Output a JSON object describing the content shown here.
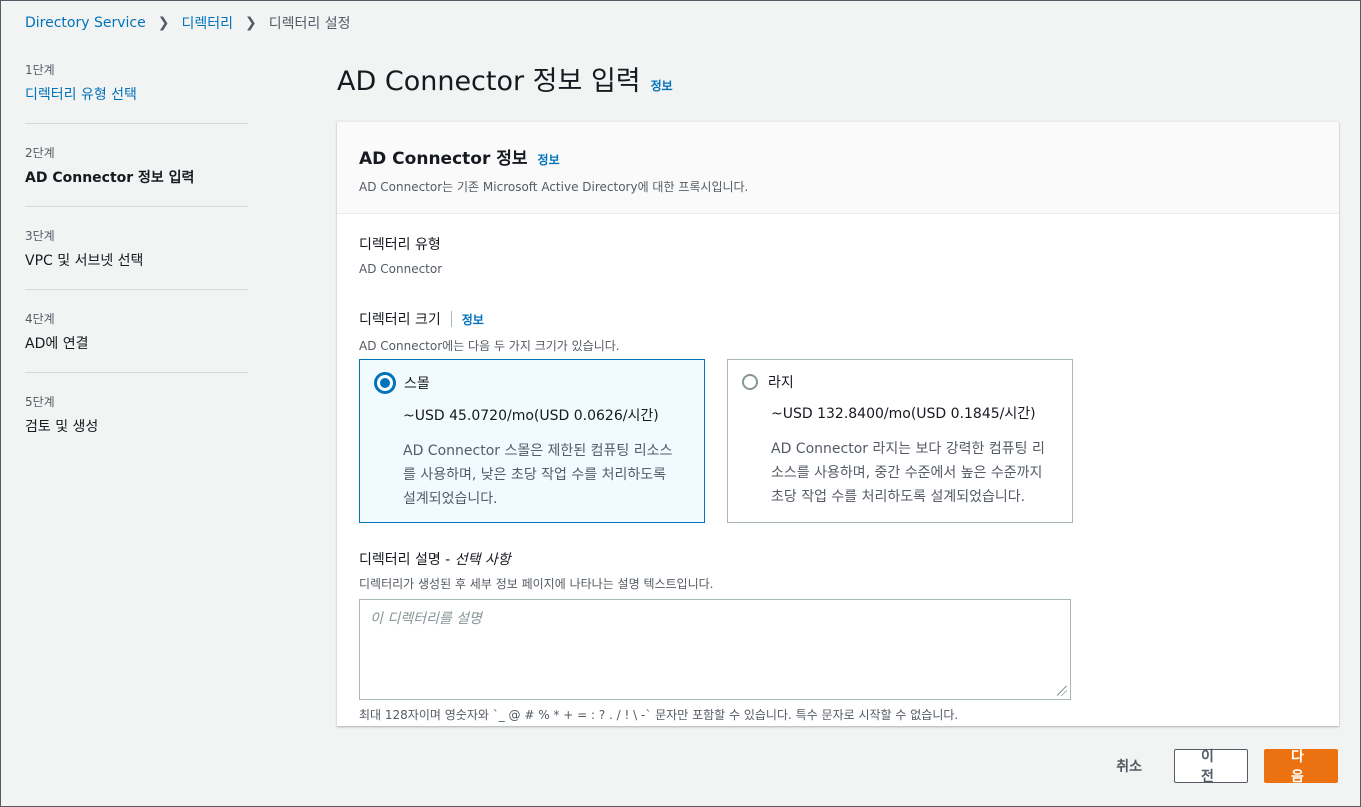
{
  "breadcrumb": {
    "items": [
      "Directory Service",
      "디렉터리"
    ],
    "current": "디렉터리 설정"
  },
  "steps": [
    {
      "num": "1단계",
      "label": "디렉터리 유형 선택"
    },
    {
      "num": "2단계",
      "label": "AD Connector 정보 입력"
    },
    {
      "num": "3단계",
      "label": "VPC 및 서브넷 선택"
    },
    {
      "num": "4단계",
      "label": "AD에 연결"
    },
    {
      "num": "5단계",
      "label": "검토 및 생성"
    }
  ],
  "page": {
    "title": "AD Connector 정보 입력",
    "info": "정보"
  },
  "panel": {
    "title": "AD Connector 정보",
    "info": "정보",
    "description": "AD Connector는 기존 Microsoft Active Directory에 대한 프록시입니다."
  },
  "directory_type": {
    "label": "디렉터리 유형",
    "value": "AD Connector"
  },
  "directory_size": {
    "label": "디렉터리 크기",
    "info": "정보",
    "description": "AD Connector에는 다음 두 가지 크기가 있습니다.",
    "options": [
      {
        "name": "스몰",
        "price": "~USD 45.0720/mo(USD 0.0626/시간)",
        "desc": [
          "AD Connector 스몰은 제한된 컴퓨팅 리소스",
          "를 사용하며, 낮은 초당 작업 수를 처리하도록",
          "설계되었습니다."
        ],
        "selected": true
      },
      {
        "name": "라지",
        "price": "~USD 132.8400/mo(USD 0.1845/시간)",
        "desc": [
          "AD Connector 라지는 보다 강력한 컴퓨팅 리",
          "소스를 사용하며, 중간 수준에서 높은 수준까지",
          "초당 작업 수를 처리하도록 설계되었습니다."
        ],
        "selected": false
      }
    ]
  },
  "directory_description": {
    "label": "디렉터리 설명 - ",
    "optional": "선택 사항",
    "help": "디렉터리가 생성된 후 세부 정보 페이지에 나타나는 설명 텍스트입니다.",
    "placeholder": "이 디렉터리를 설명",
    "constraint": "최대 128자이며 영숫자와 `_ @ # % * + = : ? . / ! \\ -` 문자만 포함할 수 있습니다. 특수 문자로 시작할 수 없습니다."
  },
  "footer": {
    "cancel": "취소",
    "previous": "이전",
    "next": "다음"
  },
  "colors": {
    "link": "#0073bb",
    "primary": "#ec7211",
    "selected_tile_bg": "#f1faff"
  }
}
